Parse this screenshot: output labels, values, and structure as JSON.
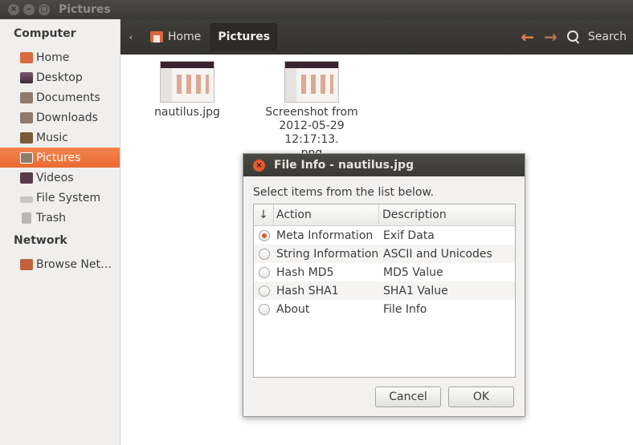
{
  "window": {
    "title": "Pictures",
    "close_glyph": "×",
    "minimize_glyph": "–",
    "maximize_glyph": "□"
  },
  "toolbar": {
    "back_chevron": "‹",
    "breadcrumbs": [
      {
        "label": "Home",
        "icon": "home-folder-icon"
      },
      {
        "label": "Pictures",
        "active": true
      }
    ],
    "back_arrow": "←",
    "forward_arrow": "→",
    "search_label": "Search"
  },
  "sidebar": {
    "computer_heading": "Computer",
    "items": [
      {
        "label": "Home",
        "icon": "home-folder-icon"
      },
      {
        "label": "Desktop",
        "icon": "desktop-icon"
      },
      {
        "label": "Documents",
        "icon": "documents-folder-icon"
      },
      {
        "label": "Downloads",
        "icon": "downloads-folder-icon"
      },
      {
        "label": "Music",
        "icon": "music-folder-icon"
      },
      {
        "label": "Pictures",
        "icon": "pictures-folder-icon",
        "selected": true
      },
      {
        "label": "Videos",
        "icon": "videos-folder-icon"
      },
      {
        "label": "File System",
        "icon": "drive-icon"
      },
      {
        "label": "Trash",
        "icon": "trash-icon"
      }
    ],
    "network_heading": "Network",
    "network_items": [
      {
        "label": "Browse Net…",
        "icon": "network-icon"
      }
    ]
  },
  "files": [
    {
      "name_lines": [
        "nautilus.jpg"
      ]
    },
    {
      "name_lines": [
        "Screenshot from",
        "2012-05-29 12:17:13.",
        "png"
      ]
    }
  ],
  "dialog": {
    "title": "File Info - nautilus.jpg",
    "close_glyph": "×",
    "prompt": "Select items from the list below.",
    "columns": {
      "sort": "↓",
      "action": "Action",
      "description": "Description"
    },
    "rows": [
      {
        "action": "Meta Information",
        "description": "Exif Data",
        "selected": true
      },
      {
        "action": "String Information",
        "description": "ASCII and Unicodes",
        "selected": false
      },
      {
        "action": "Hash MD5",
        "description": "MD5 Value",
        "selected": false
      },
      {
        "action": "Hash SHA1",
        "description": "SHA1 Value",
        "selected": false
      },
      {
        "action": "About",
        "description": "File Info",
        "selected": false
      }
    ],
    "cancel_label": "Cancel",
    "ok_label": "OK"
  },
  "colors": {
    "accent": "#e96b32",
    "titlebar": "#3b3a36",
    "radio_dot": "#e05a2a"
  }
}
